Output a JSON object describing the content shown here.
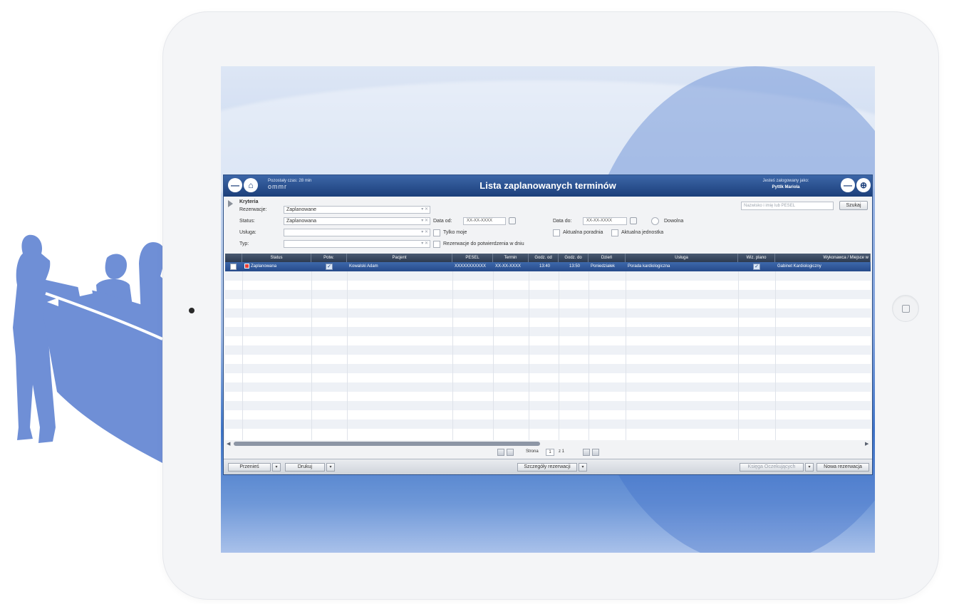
{
  "app": {
    "session": "Pozostały czas: 28 min",
    "logo": "ommr",
    "title": "Lista zaplanowanych terminów",
    "logged_label": "Jesteś zalogowany jako:",
    "user": "Pyttlk Mariola"
  },
  "criteria": {
    "title": "Kryteria",
    "rezerwacje_label": "Rezerwacje:",
    "rezerwacje_value": "Zaplanowane",
    "status_label": "Status:",
    "status_value": "Zaplanowana",
    "usluga_label": "Usługa:",
    "usluga_value": "",
    "typ_label": "Typ:",
    "typ_value": "",
    "data_od_label": "Data od:",
    "data_od_value": "XX-XX-XXXX",
    "data_do_label": "Data do:",
    "data_do_value": "XX-XX-XXXX",
    "dowolna_label": "Dowolna",
    "tylko_moje_label": "Tylko moje",
    "rezerwacje_potw_label": "Rezerwacje do potwierdzenia w dniu",
    "aktualna_poradnia_label": "Aktualna poradnia",
    "aktualna_jednostka_label": "Aktualna jednostka",
    "search_placeholder": "Nazwisko i imię lub PESEL",
    "search_button": "Szukaj"
  },
  "grid": {
    "columns": [
      "Status",
      "Potw.",
      "Pacjent",
      "PESEL",
      "Termin",
      "Godz. od",
      "Godz. do",
      "Dzień",
      "Usługa",
      "Wiz. plano",
      "Wykonawca / Miejsce w"
    ],
    "rows": [
      {
        "status": "Zaplanowana",
        "pacjent": "Kowalski Adam",
        "pesel": "XXXXXXXXXXX",
        "termin": "XX-XX-XXXX",
        "godz_od": "13:40",
        "godz_do": "13:50",
        "dzien": "Poniedziałek",
        "usluga": "Porada kardiologiczna",
        "wykonawca": "Gabinet Kardiologiczny"
      }
    ]
  },
  "pager": {
    "strona_label": "Strona",
    "page": "1",
    "of_label": "z 1"
  },
  "toolbar": {
    "przenies": "Przenieś",
    "drukuj": "Drukuj",
    "szczegoly": "Szczegóły rezerwacji",
    "ksiega": "Księga Oczekujących",
    "nowa": "Nowa rezerwacja"
  },
  "colors": {
    "titlebar": "#1c3f7a",
    "selected_row": "#2f58a0",
    "silhouette": "#6f8fd6"
  }
}
